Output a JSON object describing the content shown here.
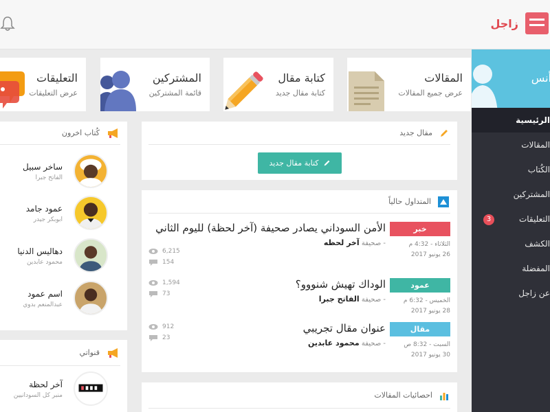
{
  "brand": {
    "name": "زاجل"
  },
  "sidebar": {
    "user_name": "أنس",
    "items": [
      {
        "label": "الرئيسية",
        "active": true
      },
      {
        "label": "المقالات"
      },
      {
        "label": "الكُتاب"
      },
      {
        "label": "المشتركين"
      },
      {
        "label": "التعليقات",
        "badge": "3"
      },
      {
        "label": "الكشف"
      },
      {
        "label": "المفضلة"
      },
      {
        "label": "عن زاجل"
      }
    ]
  },
  "cards": [
    {
      "title": "المقالات",
      "subtitle": "عرض جميع المقالات"
    },
    {
      "title": "كتابة مقال",
      "subtitle": "كتابة مقال جديد"
    },
    {
      "title": "المشتركين",
      "subtitle": "قائمة المشتركين"
    },
    {
      "title": "التعليقات",
      "subtitle": "عرض التعليقات"
    }
  ],
  "new_article": {
    "heading": "مقال جديد",
    "button": "كتابة مقال جديد"
  },
  "trending": {
    "heading": "المتداول حالياً",
    "items": [
      {
        "tag": "خبر",
        "tag_color": "#e8525f",
        "day_time": "الثلاثاء - 4:32 م",
        "date": "26 يونيو 2017",
        "title": "الأمن السوداني يصادر صحيفة (آخر لحظة) لليوم الثاني",
        "source_prefix": "- صحيفة",
        "source": "آخر لحظه",
        "views": "6,215",
        "comments": "154"
      },
      {
        "tag": "عمود",
        "tag_color": "#3fb6a4",
        "day_time": "الخميس - 6:32 م",
        "date": "28 يونيو 2017",
        "title": "الوداك تهيش شنووو؟",
        "source_prefix": "- صحيفة",
        "source": "الفاتح جبرا",
        "views": "1,594",
        "comments": "73"
      },
      {
        "tag": "مقال",
        "tag_color": "#5bbfe0",
        "day_time": "السبت - 8:32 ص",
        "date": "30 يونيو 2017",
        "title": "عنوان مقال تجريبي",
        "source_prefix": "- صحيفة",
        "source": "محمود عابدين",
        "views": "912",
        "comments": "23"
      }
    ]
  },
  "stats": {
    "heading": "احصائيات المقالات"
  },
  "writers": {
    "heading": "كُتاب اخرون",
    "items": [
      {
        "name": "ساخر سبيل",
        "sub": "الفاتح جبرا"
      },
      {
        "name": "عمود جامد",
        "sub": "ابوبكر جيدر"
      },
      {
        "name": "دهاليس الدنيا",
        "sub": "محمود عابدين"
      },
      {
        "name": "اسم عمود",
        "sub": "عبدالمنعم بدوي"
      }
    ]
  },
  "channels": {
    "heading": "قنواتي",
    "items": [
      {
        "name": "آخر لحظة",
        "sub": "منبر كل السودانيين"
      }
    ]
  }
}
